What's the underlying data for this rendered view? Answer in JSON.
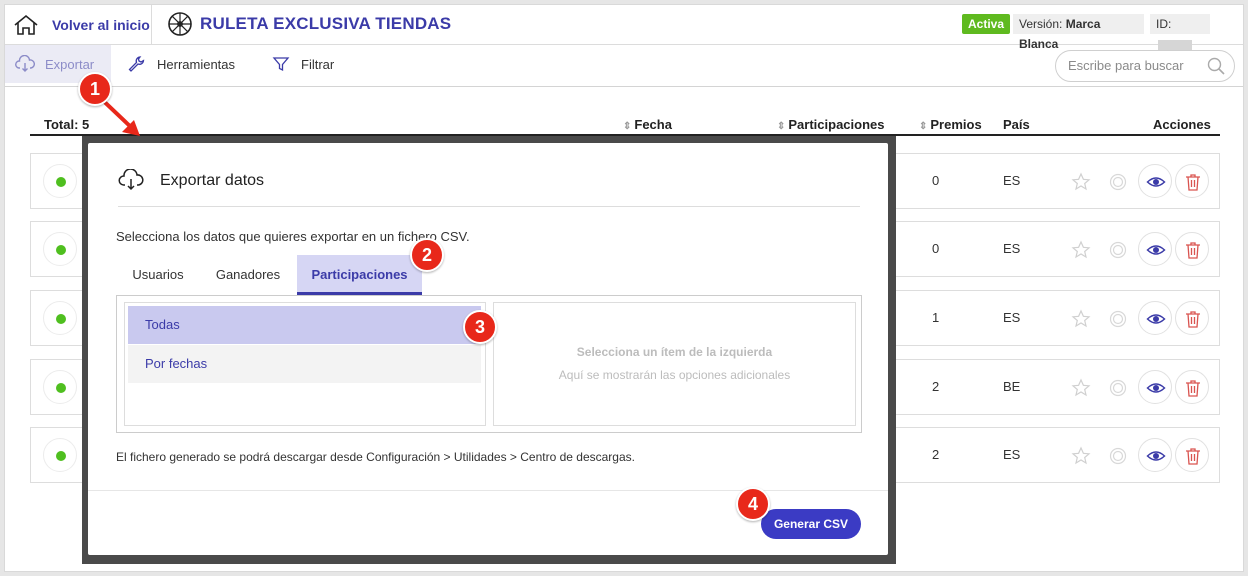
{
  "header": {
    "home_label": "Volver al inicio",
    "app_title": "RULETA EXCLUSIVA TIENDAS",
    "status": "Activa",
    "version_prefix": "Versión:",
    "version_value": "Marca Blanca",
    "id_label": "ID:"
  },
  "toolbar": {
    "export": "Exportar",
    "tools": "Herramientas",
    "filter": "Filtrar",
    "search_placeholder": "Escribe para buscar"
  },
  "table": {
    "total": "Total: 5",
    "columns": {
      "date": "Fecha",
      "participations": "Participaciones",
      "prizes": "Premios",
      "country": "País",
      "actions": "Acciones"
    },
    "rows": [
      {
        "prizes": "0",
        "country": "ES"
      },
      {
        "prizes": "0",
        "country": "ES"
      },
      {
        "prizes": "1",
        "country": "ES"
      },
      {
        "prizes": "2",
        "country": "BE"
      },
      {
        "prizes": "2",
        "country": "ES"
      }
    ]
  },
  "modal": {
    "title": "Exportar datos",
    "description": "Selecciona los datos que quieres exportar en un fichero CSV.",
    "tabs": [
      "Usuarios",
      "Ganadores",
      "Participaciones"
    ],
    "options": [
      "Todas",
      "Por fechas"
    ],
    "detail_title": "Selecciona un ítem de la izquierda",
    "detail_sub": "Aquí se mostrarán las opciones adicionales",
    "note": "El fichero generado se podrá descargar desde Configuración > Utilidades > Centro de descargas.",
    "generate_button": "Generar CSV"
  },
  "callouts": [
    "1",
    "2",
    "3",
    "4"
  ],
  "colors": {
    "brand": "#3b3ba8",
    "active": "#5fba1f",
    "callout": "#e8281a",
    "delete": "#d9534f"
  }
}
